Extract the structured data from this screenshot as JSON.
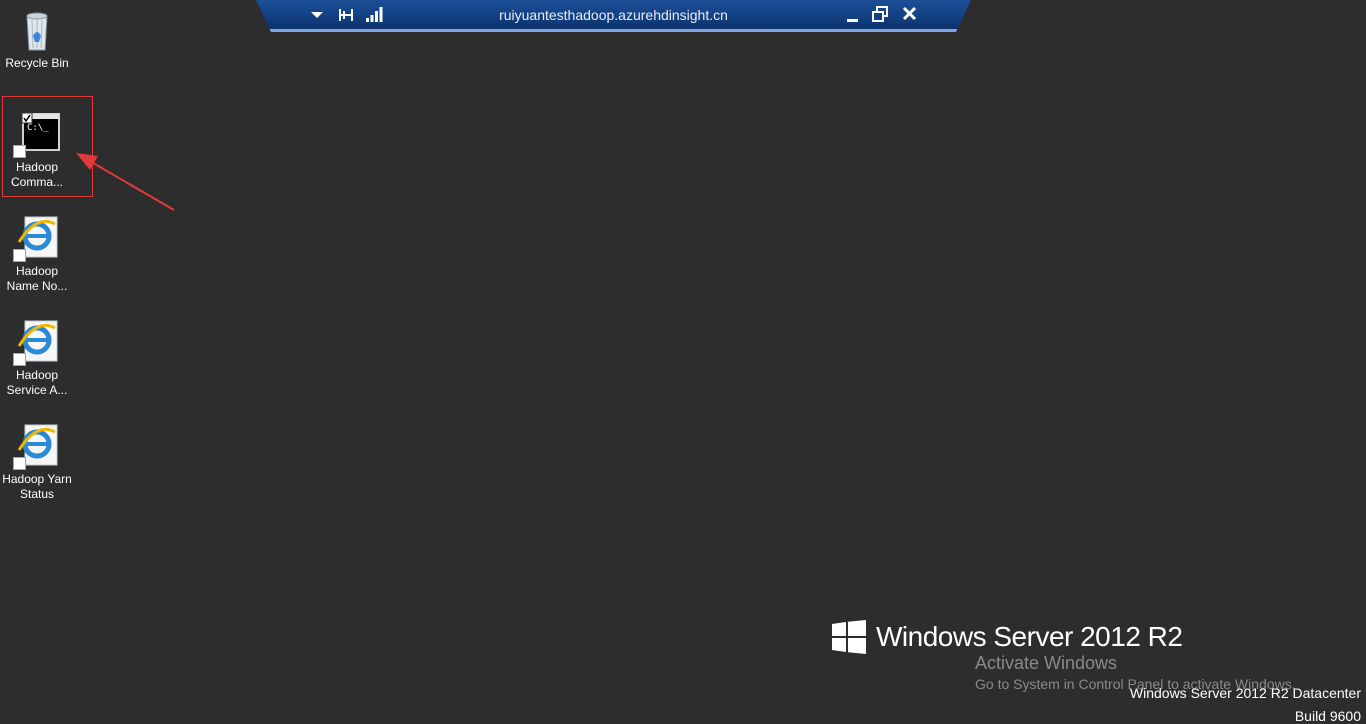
{
  "rdp_bar": {
    "title": "ruiyuantesthadoop.azurehdinsight.cn",
    "icons": [
      "dropdown-arrow-icon",
      "pin-icon",
      "signal-bars-icon",
      "minimize-icon",
      "restore-icon",
      "close-icon"
    ]
  },
  "desktop_icons": [
    {
      "label": "Recycle Bin",
      "icon": "recycle-bin-icon"
    },
    {
      "label": "Hadoop Comma...",
      "icon": "command-prompt-icon",
      "selected": true
    },
    {
      "label": "Hadoop Name No...",
      "icon": "internet-explorer-icon"
    },
    {
      "label": "Hadoop Service A...",
      "icon": "internet-explorer-icon"
    },
    {
      "label": "Hadoop Yarn Status",
      "icon": "internet-explorer-icon"
    }
  ],
  "labels": {
    "recycle": [
      "Recycle Bin"
    ],
    "cmd": [
      "Hadoop",
      "Comma..."
    ],
    "namenode": [
      "Hadoop",
      "Name No..."
    ],
    "service": [
      "Hadoop",
      "Service A..."
    ],
    "yarn": [
      "Hadoop Yarn",
      "Status"
    ]
  },
  "watermark": {
    "brand": "Windows Server 2012 R2",
    "activate_title": "Activate Windows",
    "activate_sub": "Go to System in Control Panel to activate Windows.",
    "edition": "Windows Server 2012 R2 Datacenter",
    "build": "Build 9600"
  },
  "colors": {
    "desktop_bg": "#2d2d2d",
    "rdp_bar": "#123f82",
    "annotation_red": "#e03a3a"
  }
}
